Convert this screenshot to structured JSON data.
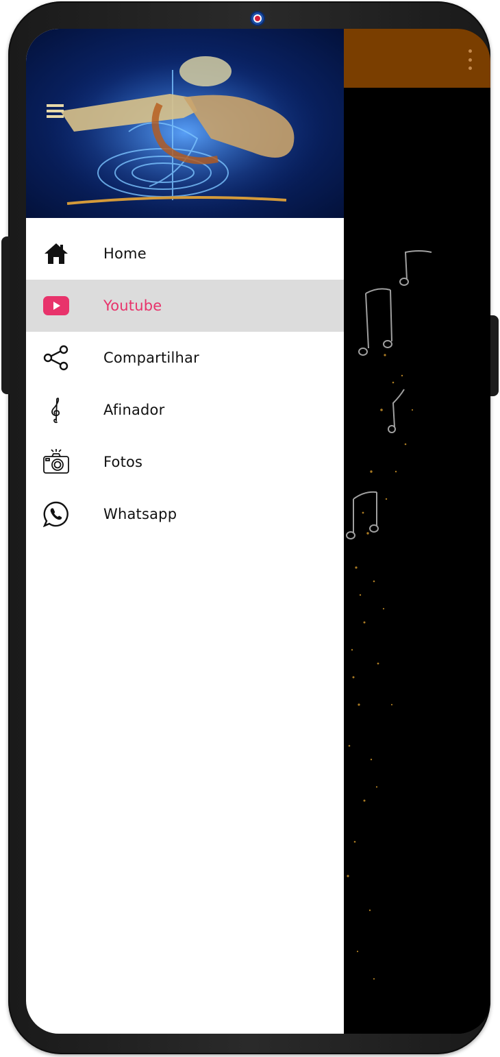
{
  "drawer": {
    "header_image": "guitar-artwork",
    "items": [
      {
        "label": "Home",
        "icon": "home-icon",
        "active": false
      },
      {
        "label": "Youtube",
        "icon": "youtube-icon",
        "active": true
      },
      {
        "label": "Compartilhar",
        "icon": "share-icon",
        "active": false
      },
      {
        "label": "Afinador",
        "icon": "treble-clef-icon",
        "active": false
      },
      {
        "label": "Fotos",
        "icon": "camera-icon",
        "active": false
      },
      {
        "label": "Whatsapp",
        "icon": "whatsapp-icon",
        "active": false
      }
    ]
  },
  "toolbar": {
    "overflow_icon": "more-vert-icon"
  },
  "colors": {
    "toolbar": "#7a3e00",
    "active_label": "#e8336b",
    "active_row": "#dcdcdc",
    "youtube_icon": "#e8336b"
  }
}
